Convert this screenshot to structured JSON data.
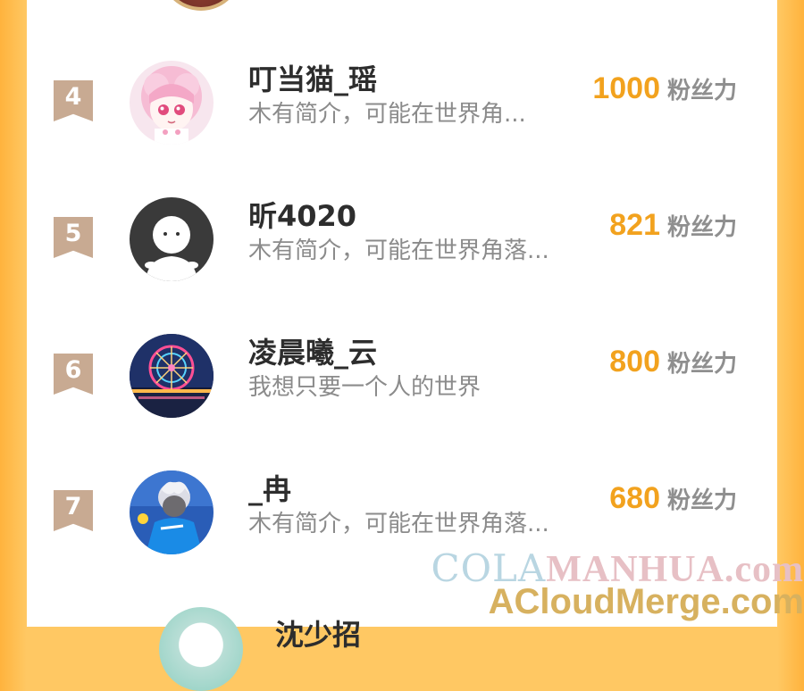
{
  "ranking": {
    "score_unit": "粉丝力",
    "entries": [
      {
        "rank": "4",
        "name": "叮当猫_瑶",
        "bio": "木有简介，可能在世界角...",
        "score": "1000",
        "avatar_icon": "anime-girl-pink-hair-avatar"
      },
      {
        "rank": "5",
        "name": "昕4020",
        "bio": "木有简介，可能在世界角落...",
        "score": "821",
        "avatar_icon": "default-ghost-avatar"
      },
      {
        "rank": "6",
        "name": "凌晨曦_云",
        "bio": "我想只要一个人的世界",
        "score": "800",
        "avatar_icon": "ferris-wheel-avatar"
      },
      {
        "rank": "7",
        "name": "_冉",
        "bio": "木有简介，可能在世界角落...",
        "score": "680",
        "avatar_icon": "anime-boy-blue-avatar"
      }
    ],
    "partial_next_name": "沈少招"
  },
  "watermark": {
    "line1_cola": "COLA",
    "line1_rest": "MANHUA.com",
    "line2": "ACloudMerge.com"
  },
  "colors": {
    "accent": "#f2a21e",
    "background_border": "#ffc863",
    "badge": "#c8aa92"
  }
}
